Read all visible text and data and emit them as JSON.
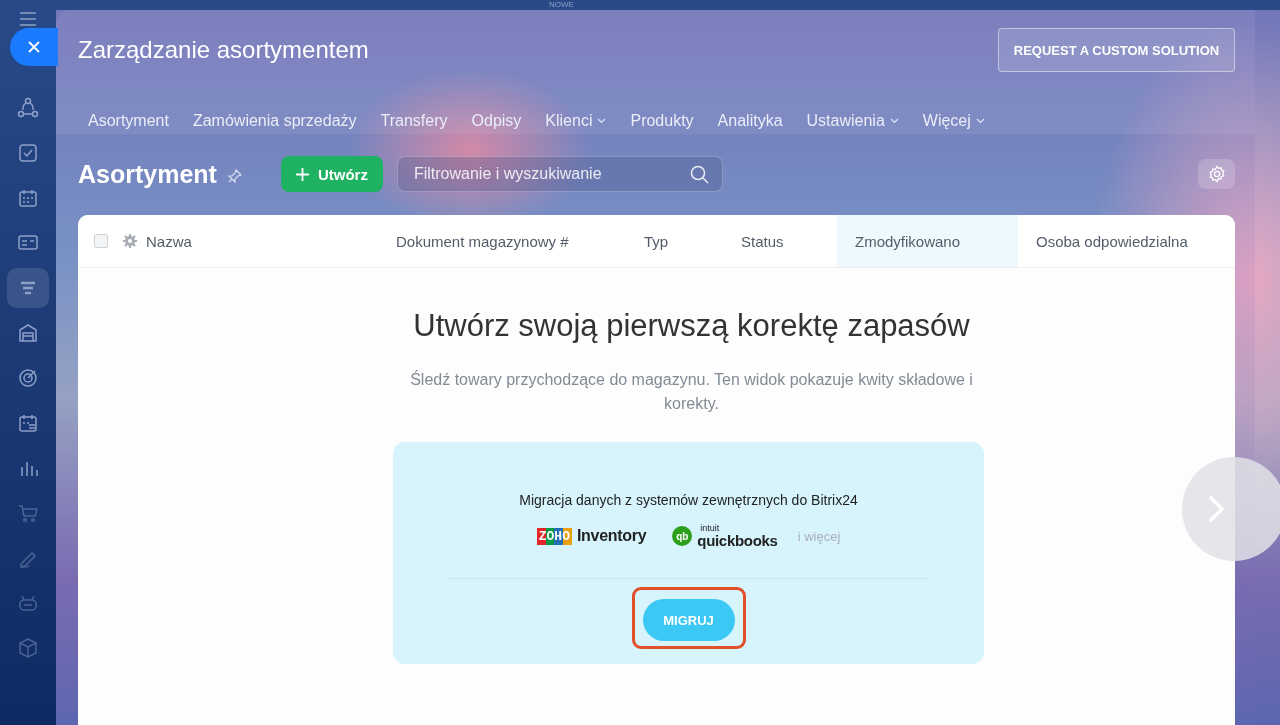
{
  "top_bar": {
    "badge": "NOWE"
  },
  "sidebar": {
    "items": [
      {
        "selected": false
      },
      {
        "selected": false
      },
      {
        "selected": false
      },
      {
        "selected": false
      },
      {
        "selected": true
      },
      {
        "selected": false
      },
      {
        "selected": false
      },
      {
        "selected": false
      },
      {
        "selected": false
      },
      {
        "selected": false
      },
      {
        "selected": false
      },
      {
        "selected": false
      },
      {
        "selected": false
      }
    ]
  },
  "window": {
    "title": "Zarządzanie asortymentem",
    "action_button": "REQUEST A CUSTOM SOLUTION"
  },
  "tabs": [
    {
      "label": "Asortyment",
      "dropdown": false
    },
    {
      "label": "Zamówienia sprzedaży",
      "dropdown": false
    },
    {
      "label": "Transfery",
      "dropdown": false
    },
    {
      "label": "Odpisy",
      "dropdown": false
    },
    {
      "label": "Klienci",
      "dropdown": true
    },
    {
      "label": "Produkty",
      "dropdown": false
    },
    {
      "label": "Analityka",
      "dropdown": false
    },
    {
      "label": "Ustawienia",
      "dropdown": true
    },
    {
      "label": "Więcej",
      "dropdown": true
    }
  ],
  "toolbar": {
    "heading": "Asortyment",
    "create_button": "Utwórz",
    "search": {
      "placeholder": "Filtrowanie i wyszukiwanie"
    }
  },
  "table": {
    "select_all_checked": false,
    "columns": [
      {
        "label": "Nazwa",
        "selected": false
      },
      {
        "label": "Dokument magazynowy #",
        "selected": false
      },
      {
        "label": "Typ",
        "selected": false
      },
      {
        "label": "Status",
        "selected": false
      },
      {
        "label": "Zmodyfikowano",
        "selected": true
      },
      {
        "label": "Osoba odpowiedzialna",
        "selected": false
      }
    ]
  },
  "empty_state": {
    "title": "Utwórz swoją pierwszą korektę zapasów",
    "description": "Śledź towary przychodzące do magazynu. Ten widok pokazuje kwity składowe i korekty.",
    "migration": {
      "text": "Migracja danych z systemów zewnętrznych do Bitrix24",
      "logos": [
        {
          "kind": "zoho",
          "mark": "ZOHO",
          "name": "Inventory"
        },
        {
          "kind": "quickbooks",
          "mark": "qb",
          "superscript": "intuit",
          "name": "quickbooks"
        }
      ],
      "more": "i więcej",
      "button": "MIGRUJ",
      "highlighted": true
    }
  }
}
